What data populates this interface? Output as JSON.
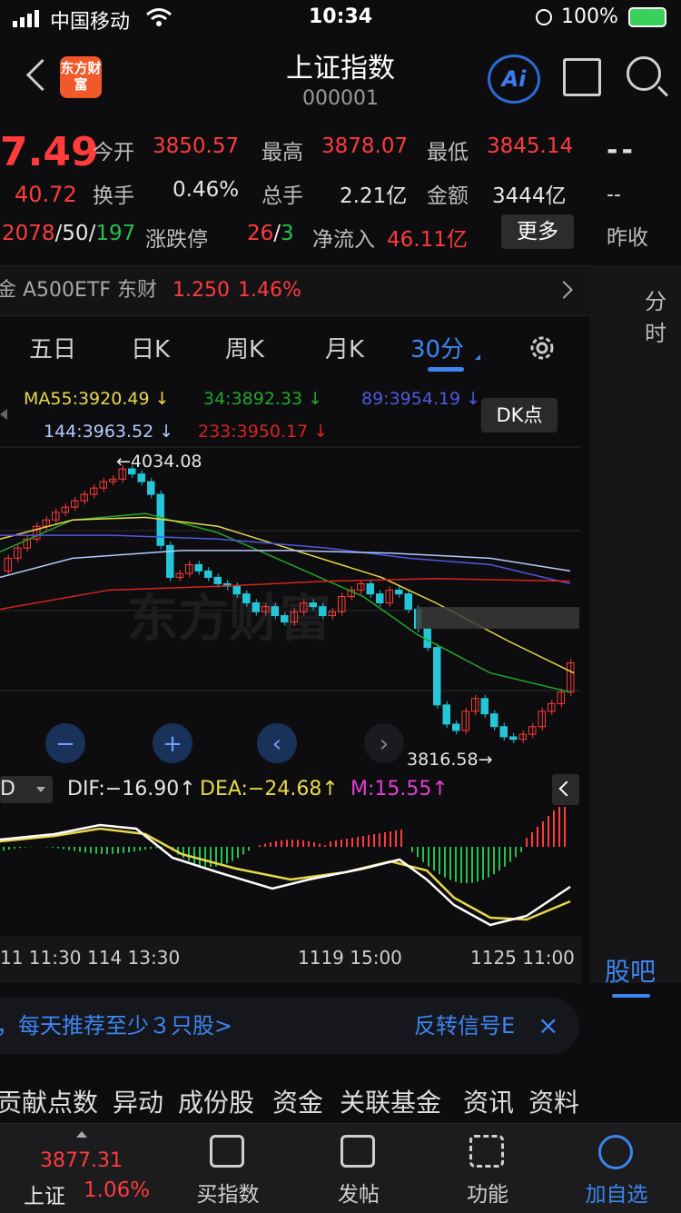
{
  "status": {
    "carrier": "中国移动",
    "time": "10:34",
    "battery": "100%"
  },
  "header": {
    "title": "上证指数",
    "code": "000001",
    "logo": "东方财富",
    "ai_label": "Ai"
  },
  "quote": {
    "price": "7.49",
    "change": "40.72",
    "open_label": "今开",
    "open": "3850.57",
    "high_label": "最高",
    "high": "3878.07",
    "low_label": "最低",
    "low": "3845.14",
    "turnover_label": "换手",
    "turnover": "0.46%",
    "volume_label": "总手",
    "volume": "2.21亿",
    "amount_label": "金额",
    "amount": "3444亿",
    "up_count": "2078",
    "flat_count": "50",
    "down_count": "197",
    "limit_label": "涨跌停",
    "limit_up": "26",
    "limit_down": "3",
    "netflow_label": "净流入",
    "netflow": "46.11亿",
    "more_label": "更多",
    "dash_big": "--",
    "dash_small": "--",
    "prev_close_label": "昨收"
  },
  "etf": {
    "name": "金 A500ETF 东财",
    "price": "1.250",
    "pct": "1.46%"
  },
  "side": {
    "fenshi": "分时",
    "guba": "股吧"
  },
  "tabs": [
    "五日",
    "日K",
    "周K",
    "月K",
    "30分"
  ],
  "active_tab": "30分",
  "ma": {
    "ma55": "MA55:3920.49",
    "ma34": "34:3892.33",
    "ma89": "89:3954.19",
    "ma144": "144:3963.52",
    "ma233": "233:3950.17",
    "arrow": "↓",
    "dk_label": "DK点"
  },
  "kchart_labels": {
    "high_mark": "4034.08",
    "low_mark": "3816.58",
    "watermark": "东方财富"
  },
  "macd": {
    "selector": "D",
    "dif": "DIF:−16.90",
    "dea": "DEA:−24.68",
    "m": "M:15.55",
    "arrow": "↑"
  },
  "time_axis": [
    "11 11:30",
    "114 13:30",
    "1119 15:00",
    "1125 11:00"
  ],
  "promo": {
    "text": "，每天推荐至少３只股>",
    "signal": "反转信号E",
    "close": "×"
  },
  "tabs2": [
    "贡献点数",
    "异动",
    "成份股",
    "资金",
    "关联基金",
    "资讯",
    "资料"
  ],
  "bottom": {
    "index_name": "上证",
    "index_price": "3877.31",
    "index_pct": "1.06%",
    "items": [
      "买指数",
      "发帖",
      "功能",
      "加自选"
    ]
  },
  "colors": {
    "up": "#ff3b3b",
    "down": "#25c6d8",
    "accent": "#3d86f0",
    "ma55": "#e8d84a",
    "ma34": "#22a52a",
    "ma89": "#5057e0",
    "ma144": "#b6c8ff",
    "ma233": "#d8231f"
  }
}
